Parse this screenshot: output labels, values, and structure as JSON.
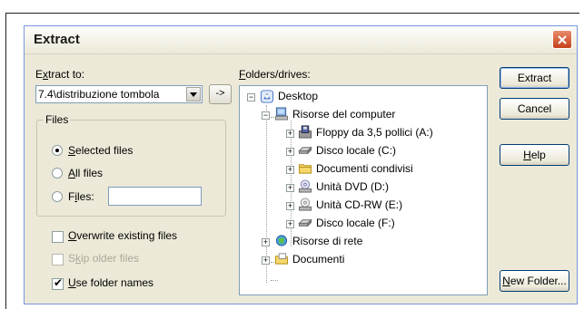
{
  "window": {
    "title": "Extract"
  },
  "extract_to": {
    "label_before": "E",
    "label_accel": "x",
    "label_after": "tract to:",
    "value": "7.4\\distribuzione tombola",
    "go_button": "->"
  },
  "files_group": {
    "title": "Files",
    "options": [
      {
        "accel": "S",
        "rest": "elected files",
        "checked": true
      },
      {
        "accel": "A",
        "rest": "ll files",
        "checked": false
      },
      {
        "pre": "F",
        "accel": "i",
        "rest": "les:",
        "checked": false
      }
    ],
    "files_value": ""
  },
  "checkboxes": [
    {
      "accel": "O",
      "rest": "verwrite existing files",
      "checked": false,
      "disabled": false
    },
    {
      "pre": "S",
      "accel": "k",
      "rest": "ip older files",
      "checked": false,
      "disabled": true
    },
    {
      "accel": "U",
      "rest": "se folder names",
      "checked": true,
      "disabled": false
    }
  ],
  "folders": {
    "label_accel": "F",
    "label_rest": "olders/drives:",
    "tree": [
      {
        "label": "Desktop",
        "icon": "desktop-icon",
        "expanded": true
      },
      {
        "label": "Risorse del computer",
        "icon": "computer-icon",
        "expanded": true
      },
      {
        "label": "Floppy da 3,5 pollici (A:)",
        "icon": "floppy-icon",
        "expanded": false
      },
      {
        "label": "Disco locale (C:)",
        "icon": "hard-drive-icon",
        "expanded": false
      },
      {
        "label": "Documenti condivisi",
        "icon": "folder-icon",
        "expanded": false
      },
      {
        "label": "Unità DVD (D:)",
        "icon": "dvd-icon",
        "expanded": false
      },
      {
        "label": "Unità CD-RW (E:)",
        "icon": "cd-icon",
        "expanded": false
      },
      {
        "label": "Disco locale (F:)",
        "icon": "hard-drive-icon",
        "expanded": false
      },
      {
        "label": "Risorse di rete",
        "icon": "network-icon",
        "expanded": false
      },
      {
        "label": "Documenti",
        "icon": "documents-icon",
        "expanded": false
      }
    ]
  },
  "buttons": {
    "extract": "Extract",
    "cancel": "Cancel",
    "help_accel": "H",
    "help_rest": "elp",
    "new_folder_accel": "N",
    "new_folder_rest": "ew Folder..."
  },
  "colors": {
    "dialog_bg": "#ece9d8",
    "title_text": "#1a1a1a",
    "close_button": "#c6411c",
    "input_border": "#7f9db9"
  }
}
